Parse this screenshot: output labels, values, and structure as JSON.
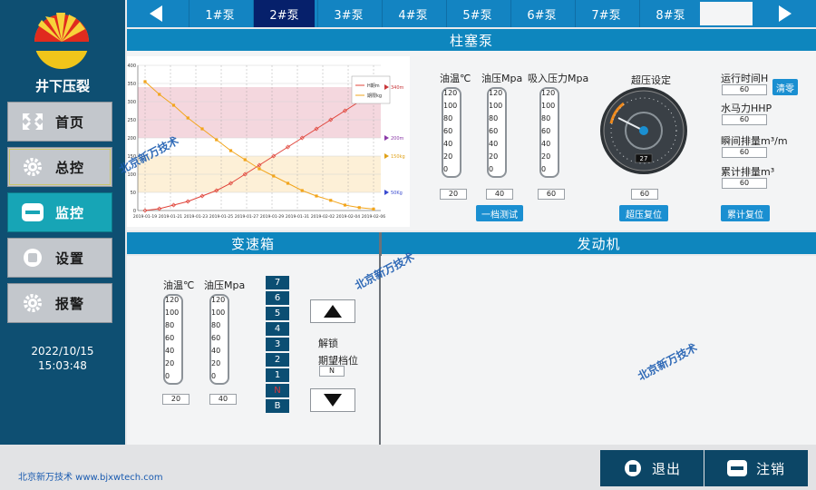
{
  "app": {
    "title": "井下压裂"
  },
  "sidebar": {
    "items": [
      {
        "label": "首页",
        "icon": "expand-arrows-icon"
      },
      {
        "label": "总控",
        "icon": "gear-icon"
      },
      {
        "label": "监控",
        "icon": "minus-square-icon"
      },
      {
        "label": "设置",
        "icon": "circle-square-icon"
      },
      {
        "label": "报警",
        "icon": "gear-icon"
      }
    ],
    "date": "2022/10/15",
    "time": "15:03:48"
  },
  "tabs": [
    "1#泵",
    "2#泵",
    "3#泵",
    "4#泵",
    "5#泵",
    "6#泵",
    "7#泵",
    "8#泵"
  ],
  "pump": {
    "title": "柱塞泵",
    "oil_temp_label": "油温℃",
    "oil_press_label": "油压Mpa",
    "suction_label": "吸入压力Mpa",
    "oil_temp_value": "20",
    "oil_press_value": "40",
    "suction_value": "60",
    "test_button": "一档测试",
    "overpressure_label": "超压设定",
    "overpressure_value": "60",
    "overpressure_reset": "超压复位",
    "gauge_readout": "27",
    "runtime_label": "运行时间H",
    "runtime_value": "60",
    "clear_button": "清零",
    "hhp_label": "水马力HHP",
    "hhp_value": "60",
    "inst_flow_label": "瞬间排量m³/m",
    "inst_flow_value": "60",
    "total_flow_label": "累计排量m³",
    "total_flow_value": "60",
    "total_reset": "累计复位",
    "tube_scale": [
      "120",
      "100",
      "80",
      "60",
      "40",
      "20",
      "0"
    ]
  },
  "gearbox": {
    "title": "变速箱",
    "oil_temp_label": "油温℃",
    "oil_press_label": "油压Mpa",
    "oil_temp_value": "20",
    "oil_press_value": "40",
    "gears": [
      "7",
      "6",
      "5",
      "4",
      "3",
      "2",
      "1",
      "N",
      "B"
    ],
    "unlock_label": "解锁",
    "expected_gear_label": "期望档位",
    "expected_gear_value": "N"
  },
  "engine": {
    "title": "发动机"
  },
  "footer": {
    "company": "北京新万技术  www.bjxwtech.com",
    "exit_label": "退出",
    "logout_label": "注销"
  },
  "watermark": "北京新万技术",
  "chart_data": {
    "type": "line",
    "x": [
      "2019-01-19",
      "2019-01-21",
      "2019-01-23",
      "2019-01-25",
      "2019-01-27",
      "2019-01-29",
      "2019-01-31",
      "2019-02-02",
      "2019-02-04",
      "2019-02-06"
    ],
    "ylim": [
      0,
      400
    ],
    "yticks": [
      "0",
      "50",
      "100",
      "150",
      "200",
      "250",
      "300",
      "350",
      "400"
    ],
    "series": [
      {
        "name": "H期m",
        "color": "#e0443a",
        "values": [
          0,
          5,
          15,
          25,
          40,
          55,
          75,
          100,
          125,
          150,
          175,
          200,
          225,
          250,
          275,
          300,
          330
        ]
      },
      {
        "name": "期限kg",
        "color": "#f2a51c",
        "values": [
          355,
          320,
          290,
          255,
          225,
          195,
          165,
          140,
          115,
          95,
          75,
          55,
          40,
          28,
          15,
          8,
          4
        ]
      }
    ],
    "right_markers": [
      {
        "label": "340m",
        "color": "#c8373b"
      },
      {
        "label": "200m",
        "color": "#8b3aa8"
      },
      {
        "label": "150kg",
        "color": "#e0a21a"
      },
      {
        "label": "50Kg",
        "color": "#3a4bd0"
      }
    ],
    "bands": [
      {
        "from": 200,
        "to": 340,
        "color": "#f4d7de"
      },
      {
        "from": 50,
        "to": 150,
        "color": "#fdf0d7"
      }
    ]
  }
}
